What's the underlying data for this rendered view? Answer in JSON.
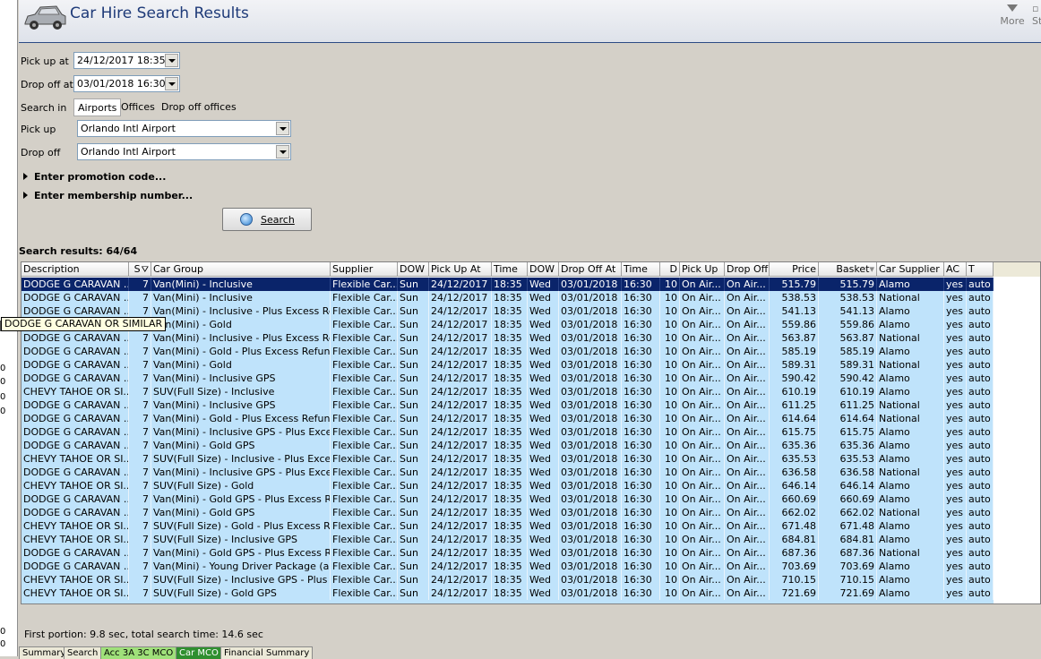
{
  "app": {
    "title": "Car Hire Search Results"
  },
  "toolbar": {
    "more_label": "More",
    "st_label": "St"
  },
  "left_strip": {
    "numbers": [
      "0",
      "0",
      "0",
      "0",
      "0",
      "0"
    ]
  },
  "form": {
    "pickup_at_label": "Pick up at",
    "pickup_at_value": "24/12/2017 18:35",
    "dropoff_at_label": "Drop off at",
    "dropoff_at_value": "03/01/2018 16:30",
    "search_in_label": "Search in",
    "search_in_options": [
      "Airports",
      "Offices",
      "Drop off offices"
    ],
    "search_in_selected": "Airports",
    "pickup_label": "Pick up",
    "pickup_value": "Orlando Intl Airport",
    "dropoff_label": "Drop off",
    "dropoff_value": "Orlando Intl Airport",
    "promo_label": "Enter promotion code...",
    "membership_label": "Enter membership number...",
    "search_button": "Search"
  },
  "results": {
    "count_label": "Search results: 64/64",
    "tooltip": "DODGE G CARAVAN OR SIMILAR",
    "columns": [
      "Description",
      "S",
      "Car Group",
      "Supplier",
      "DOW",
      "Pick Up At",
      "Time",
      "DOW",
      "Drop Off At",
      "Time",
      "D",
      "Pick Up",
      "Drop Off",
      "Price",
      "Basket",
      "Car Supplier",
      "AC",
      "T"
    ],
    "rows": [
      [
        "DODGE G CARAVAN ...",
        "7",
        "Van(Mini) - Inclusive",
        "Flexible Car...",
        "Sun",
        "24/12/2017",
        "18:35",
        "Wed",
        "03/01/2018",
        "16:30",
        "10",
        "On Air...",
        "On Air...",
        "515.79",
        "515.79",
        "Alamo",
        "yes",
        "auto"
      ],
      [
        "DODGE G CARAVAN ...",
        "7",
        "Van(Mini) - Inclusive",
        "Flexible Car...",
        "Sun",
        "24/12/2017",
        "18:35",
        "Wed",
        "03/01/2018",
        "16:30",
        "10",
        "On Air...",
        "On Air...",
        "538.53",
        "538.53",
        "National",
        "yes",
        "auto"
      ],
      [
        "DODGE G CARAVAN ...",
        "7",
        "Van(Mini) - Inclusive - Plus Excess Ref...",
        "Flexible Car...",
        "Sun",
        "24/12/2017",
        "18:35",
        "Wed",
        "03/01/2018",
        "16:30",
        "10",
        "On Air...",
        "On Air...",
        "541.13",
        "541.13",
        "Alamo",
        "yes",
        "auto"
      ],
      [
        "DODGE G CARAVAN ...",
        "7",
        "Van(Mini) - Gold",
        "Flexible Car...",
        "Sun",
        "24/12/2017",
        "18:35",
        "Wed",
        "03/01/2018",
        "16:30",
        "10",
        "On Air...",
        "On Air...",
        "559.86",
        "559.86",
        "Alamo",
        "yes",
        "auto"
      ],
      [
        "DODGE G CARAVAN ...",
        "7",
        "Van(Mini) - Inclusive - Plus Excess Ref...",
        "Flexible Car...",
        "Sun",
        "24/12/2017",
        "18:35",
        "Wed",
        "03/01/2018",
        "16:30",
        "10",
        "On Air...",
        "On Air...",
        "563.87",
        "563.87",
        "National",
        "yes",
        "auto"
      ],
      [
        "DODGE G CARAVAN ...",
        "7",
        "Van(Mini) - Gold - Plus Excess Refund",
        "Flexible Car...",
        "Sun",
        "24/12/2017",
        "18:35",
        "Wed",
        "03/01/2018",
        "16:30",
        "10",
        "On Air...",
        "On Air...",
        "585.19",
        "585.19",
        "Alamo",
        "yes",
        "auto"
      ],
      [
        "DODGE G CARAVAN ...",
        "7",
        "Van(Mini) - Gold",
        "Flexible Car...",
        "Sun",
        "24/12/2017",
        "18:35",
        "Wed",
        "03/01/2018",
        "16:30",
        "10",
        "On Air...",
        "On Air...",
        "589.31",
        "589.31",
        "National",
        "yes",
        "auto"
      ],
      [
        "DODGE G CARAVAN ...",
        "7",
        "Van(Mini) - Inclusive GPS",
        "Flexible Car...",
        "Sun",
        "24/12/2017",
        "18:35",
        "Wed",
        "03/01/2018",
        "16:30",
        "10",
        "On Air...",
        "On Air...",
        "590.42",
        "590.42",
        "Alamo",
        "yes",
        "auto"
      ],
      [
        "CHEVY TAHOE OR SI...",
        "7",
        "SUV(Full Size) - Inclusive",
        "Flexible Car...",
        "Sun",
        "24/12/2017",
        "18:35",
        "Wed",
        "03/01/2018",
        "16:30",
        "10",
        "On Air...",
        "On Air...",
        "610.19",
        "610.19",
        "Alamo",
        "yes",
        "auto"
      ],
      [
        "DODGE G CARAVAN ...",
        "7",
        "Van(Mini) - Inclusive GPS",
        "Flexible Car...",
        "Sun",
        "24/12/2017",
        "18:35",
        "Wed",
        "03/01/2018",
        "16:30",
        "10",
        "On Air...",
        "On Air...",
        "611.25",
        "611.25",
        "National",
        "yes",
        "auto"
      ],
      [
        "DODGE G CARAVAN ...",
        "7",
        "Van(Mini) - Gold - Plus Excess Refund",
        "Flexible Car...",
        "Sun",
        "24/12/2017",
        "18:35",
        "Wed",
        "03/01/2018",
        "16:30",
        "10",
        "On Air...",
        "On Air...",
        "614.64",
        "614.64",
        "National",
        "yes",
        "auto"
      ],
      [
        "DODGE G CARAVAN ...",
        "7",
        "Van(Mini) - Inclusive GPS - Plus Exces...",
        "Flexible Car...",
        "Sun",
        "24/12/2017",
        "18:35",
        "Wed",
        "03/01/2018",
        "16:30",
        "10",
        "On Air...",
        "On Air...",
        "615.75",
        "615.75",
        "Alamo",
        "yes",
        "auto"
      ],
      [
        "DODGE G CARAVAN ...",
        "7",
        "Van(Mini) - Gold GPS",
        "Flexible Car...",
        "Sun",
        "24/12/2017",
        "18:35",
        "Wed",
        "03/01/2018",
        "16:30",
        "10",
        "On Air...",
        "On Air...",
        "635.36",
        "635.36",
        "Alamo",
        "yes",
        "auto"
      ],
      [
        "CHEVY TAHOE OR SI...",
        "7",
        "SUV(Full Size) - Inclusive - Plus Excess...",
        "Flexible Car...",
        "Sun",
        "24/12/2017",
        "18:35",
        "Wed",
        "03/01/2018",
        "16:30",
        "10",
        "On Air...",
        "On Air...",
        "635.53",
        "635.53",
        "Alamo",
        "yes",
        "auto"
      ],
      [
        "DODGE G CARAVAN ...",
        "7",
        "Van(Mini) - Inclusive GPS - Plus Exces...",
        "Flexible Car...",
        "Sun",
        "24/12/2017",
        "18:35",
        "Wed",
        "03/01/2018",
        "16:30",
        "10",
        "On Air...",
        "On Air...",
        "636.58",
        "636.58",
        "National",
        "yes",
        "auto"
      ],
      [
        "CHEVY TAHOE OR SI...",
        "7",
        "SUV(Full Size) - Gold",
        "Flexible Car...",
        "Sun",
        "24/12/2017",
        "18:35",
        "Wed",
        "03/01/2018",
        "16:30",
        "10",
        "On Air...",
        "On Air...",
        "646.14",
        "646.14",
        "Alamo",
        "yes",
        "auto"
      ],
      [
        "DODGE G CARAVAN ...",
        "7",
        "Van(Mini) - Gold GPS - Plus Excess Ref...",
        "Flexible Car...",
        "Sun",
        "24/12/2017",
        "18:35",
        "Wed",
        "03/01/2018",
        "16:30",
        "10",
        "On Air...",
        "On Air...",
        "660.69",
        "660.69",
        "Alamo",
        "yes",
        "auto"
      ],
      [
        "DODGE G CARAVAN ...",
        "7",
        "Van(Mini) - Gold GPS",
        "Flexible Car...",
        "Sun",
        "24/12/2017",
        "18:35",
        "Wed",
        "03/01/2018",
        "16:30",
        "10",
        "On Air...",
        "On Air...",
        "662.02",
        "662.02",
        "National",
        "yes",
        "auto"
      ],
      [
        "CHEVY TAHOE OR SI...",
        "7",
        "SUV(Full Size) - Gold - Plus Excess Ref...",
        "Flexible Car...",
        "Sun",
        "24/12/2017",
        "18:35",
        "Wed",
        "03/01/2018",
        "16:30",
        "10",
        "On Air...",
        "On Air...",
        "671.48",
        "671.48",
        "Alamo",
        "yes",
        "auto"
      ],
      [
        "CHEVY TAHOE OR SI...",
        "7",
        "SUV(Full Size) - Inclusive GPS",
        "Flexible Car...",
        "Sun",
        "24/12/2017",
        "18:35",
        "Wed",
        "03/01/2018",
        "16:30",
        "10",
        "On Air...",
        "On Air...",
        "684.81",
        "684.81",
        "Alamo",
        "yes",
        "auto"
      ],
      [
        "DODGE G CARAVAN ...",
        "7",
        "Van(Mini) - Gold GPS - Plus Excess Ref...",
        "Flexible Car...",
        "Sun",
        "24/12/2017",
        "18:35",
        "Wed",
        "03/01/2018",
        "16:30",
        "10",
        "On Air...",
        "On Air...",
        "687.36",
        "687.36",
        "National",
        "yes",
        "auto"
      ],
      [
        "DODGE G CARAVAN ...",
        "7",
        "Van(Mini) - Young Driver Package (ag...",
        "Flexible Car...",
        "Sun",
        "24/12/2017",
        "18:35",
        "Wed",
        "03/01/2018",
        "16:30",
        "10",
        "On Air...",
        "On Air...",
        "703.69",
        "703.69",
        "Alamo",
        "yes",
        "auto"
      ],
      [
        "CHEVY TAHOE OR SI...",
        "7",
        "SUV(Full Size) - Inclusive GPS - Plus E...",
        "Flexible Car...",
        "Sun",
        "24/12/2017",
        "18:35",
        "Wed",
        "03/01/2018",
        "16:30",
        "10",
        "On Air...",
        "On Air...",
        "710.15",
        "710.15",
        "Alamo",
        "yes",
        "auto"
      ],
      [
        "CHEVY TAHOE OR SI...",
        "7",
        "SUV(Full Size) - Gold GPS",
        "Flexible Car...",
        "Sun",
        "24/12/2017",
        "18:35",
        "Wed",
        "03/01/2018",
        "16:30",
        "10",
        "On Air...",
        "On Air...",
        "721.69",
        "721.69",
        "Alamo",
        "yes",
        "auto"
      ]
    ],
    "selected_row": 0
  },
  "status": {
    "text": "First portion: 9.8 sec, total search time: 14.6 sec"
  },
  "bottom_tabs": [
    "Summary",
    "Search",
    "Acc 3A 3C MCO",
    "Car MCO",
    "Financial Summary"
  ],
  "colors": {
    "title": "#1e3a78",
    "row_bg": "#bfe3fb",
    "selected_row_bg": "#0a246a",
    "tab_green": "#9fe07a",
    "tab_dark_green": "#2f8f2f"
  }
}
